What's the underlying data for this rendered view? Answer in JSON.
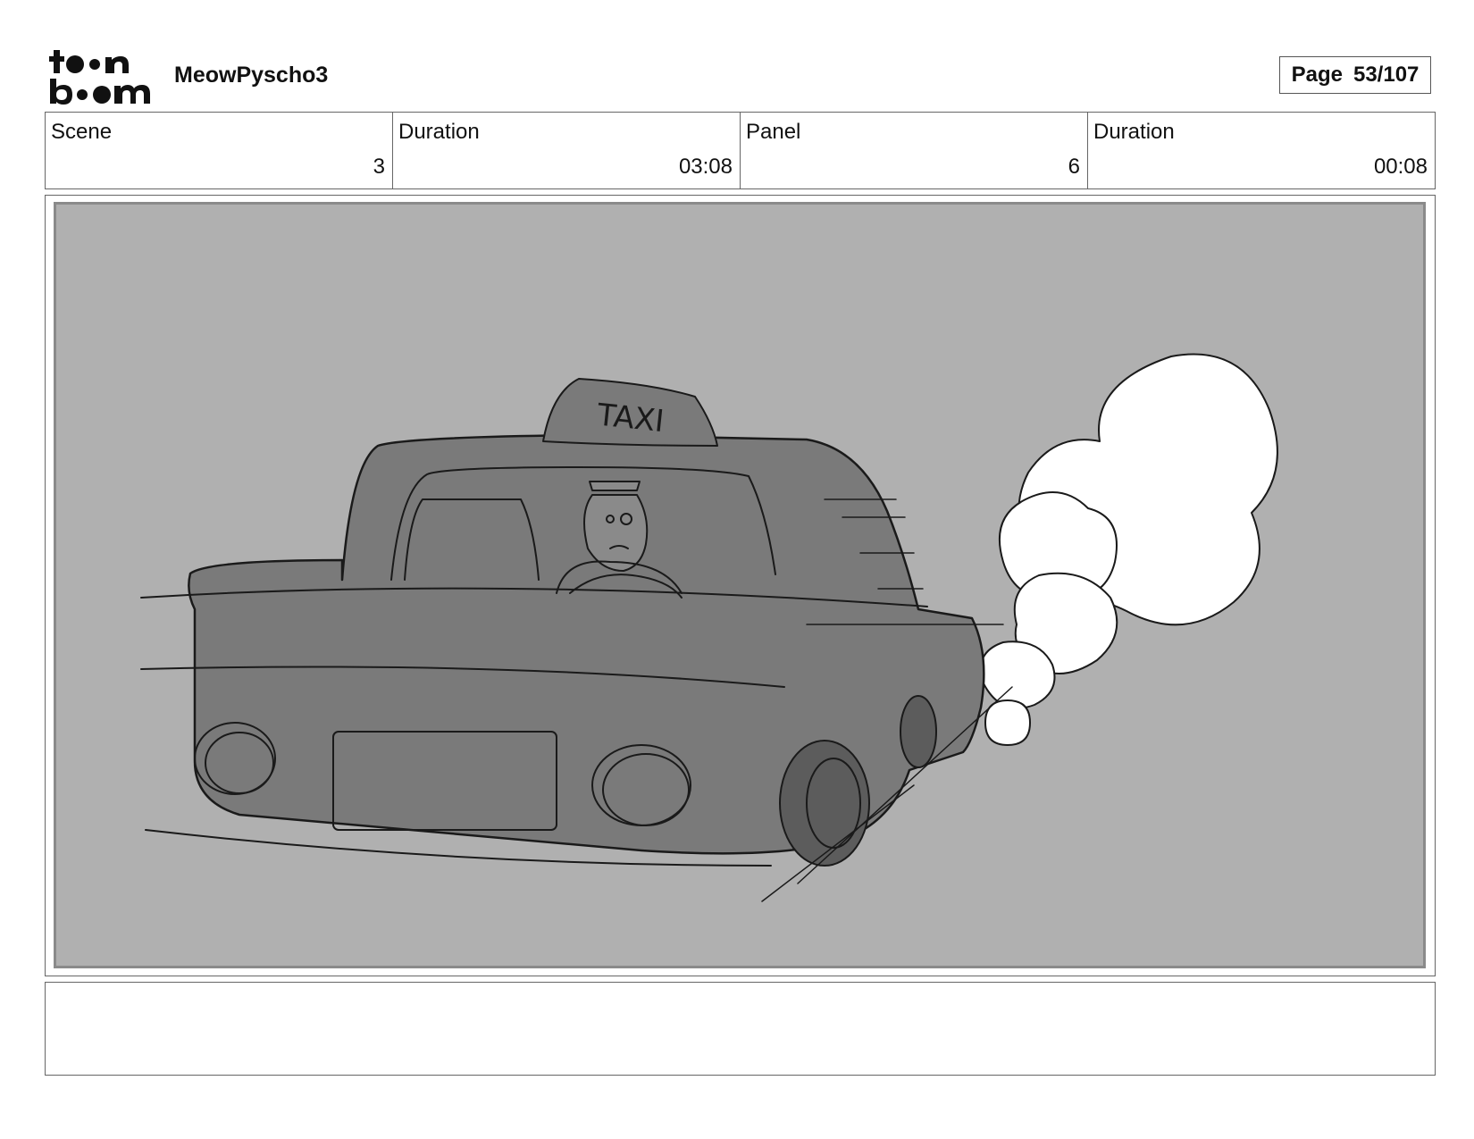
{
  "header": {
    "logo_text": "toonboom",
    "project_title": "MeowPyscho3",
    "page_label": "Page",
    "page_number": "53/107"
  },
  "info": {
    "scene_label": "Scene",
    "scene_value": "3",
    "scene_duration_label": "Duration",
    "scene_duration_value": "03:08",
    "panel_label": "Panel",
    "panel_value": "6",
    "panel_duration_label": "Duration",
    "panel_duration_value": "00:08"
  },
  "panel": {
    "sign_text": "TAXI",
    "background_color": "#b0b0b0"
  },
  "notes": {
    "text": ""
  }
}
